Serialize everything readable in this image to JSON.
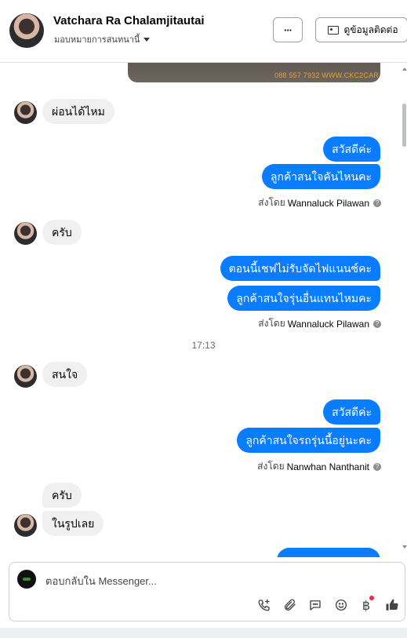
{
  "header": {
    "contact_name": "Vatchara Ra Chalamjitautai",
    "assign_label": "มอบหมายการสนทนานี้",
    "more_label": "···",
    "contact_info_label": "ดูข้อมูลติดต่อ"
  },
  "image_watermark": "088 557 7932 WWW.CKC2CAR",
  "messages": {
    "m1": "ผ่อนได้ไหม",
    "m2": "สวัสดีค่ะ",
    "m3": "ลูกค้าสนใจคันไหนคะ",
    "m4": "ครับ",
    "m5": "ตอนนี้เชฟไม่รับจัดไฟแนนซ์คะ",
    "m6": "ลูกค้าสนใจรุ่นอื่นแทนไหมคะ",
    "m7": "สนใจ",
    "m8": "สวัสดีค่ะ",
    "m9": "ลูกค้าสนใจรถรุ่นนี้อยู่นะคะ",
    "m10": "ครับ",
    "m11": "ในรูปเลย"
  },
  "sent_by": {
    "prefix": "ส่งโดย",
    "s1": "Wannaluck Pilawan",
    "s2": "Wannaluck Pilawan",
    "s3": "Nanwhan Nanthanit"
  },
  "timestamp": "17:13",
  "composer": {
    "placeholder": "ตอบกลับใน Messenger...",
    "currency_symbol": "฿"
  },
  "icons": [
    "chevron-down-icon",
    "id-card-icon",
    "help-icon",
    "phone-add-icon",
    "attachment-icon",
    "saved-reply-icon",
    "emoji-icon",
    "baht-icon",
    "thumbs-up-icon"
  ],
  "colors": {
    "outgoing_bubble": "#0a7cff",
    "incoming_bubble": "#f0f0f0",
    "notification_dot": "#f02849"
  }
}
